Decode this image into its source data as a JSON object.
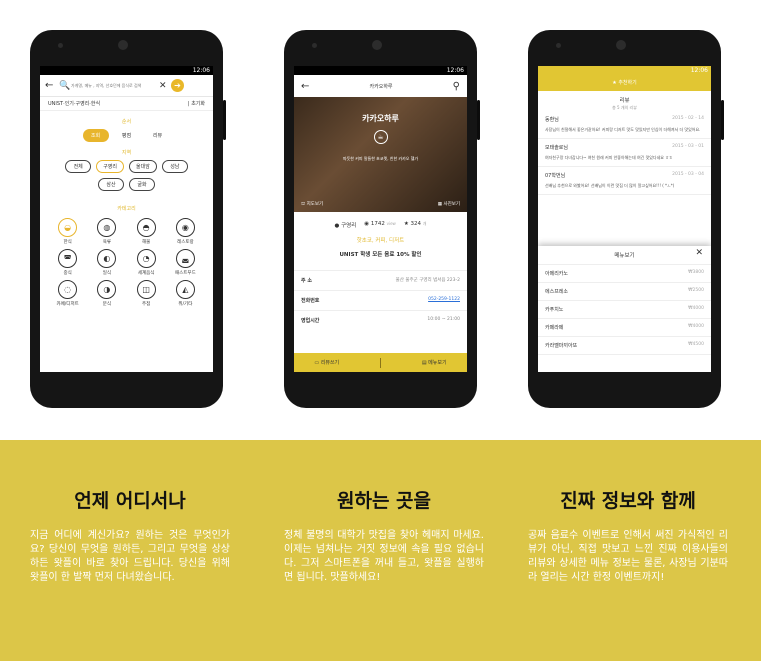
{
  "status_time": "12:06",
  "phone1": {
    "search_placeholder": "가게명, 메뉴 , 지역, 선호던에 음식로 검색",
    "crumb": "UNIST·인기·구영리·한식",
    "reset": "| 초기화",
    "order_title": "순서",
    "orders": [
      "조회",
      "평점",
      "리뷰"
    ],
    "region_title": "지역",
    "regions": [
      "전체",
      "구영리",
      "울대암",
      "성남",
      "삼산",
      "굴화"
    ],
    "category_title": "카테고리",
    "categories": [
      "한식",
      "육류",
      "해물",
      "레스토랑",
      "중식",
      "일식",
      "세계음식",
      "패스트푸드",
      "카페/디저트",
      "분식",
      "주점",
      "뷔/기타"
    ]
  },
  "phone2": {
    "topbar": "카카오하루",
    "shop_name": "카카오하루",
    "shop_desc": "따듯한 커피 말들한 초코렛, 친한 카카오 헬가",
    "map_label": "지도보기",
    "photo_label": "사진보기",
    "location": "구영리",
    "views": "1742",
    "views_unit": "view",
    "score": "324",
    "score_unit": "개",
    "tags": "핫초코, 커피, 디저트",
    "promo": "UNIST 학생 모든 음료 10% 할인",
    "info": [
      {
        "k": "주 소",
        "v": "울산 울주군 구영리 범서읍 223-2"
      },
      {
        "k": "전화번호",
        "v": "052-259-1122"
      },
      {
        "k": "영업시간",
        "v": "10:00 ~ 21:00"
      }
    ],
    "review_btn": "리뷰쓰기",
    "menu_btn": "메뉴보기"
  },
  "phone3": {
    "top": "추천하기",
    "title": "리뷰",
    "subtitle": "총 5 개의 리뷰",
    "reviews": [
      {
        "name": "동환님",
        "date": "2015 - 02 - 14",
        "text": "사장님이 친절해서 좋은거같아요! 커피랑 디저트 맛도 맛있지만 인심이 더해져서 더 맛있어요."
      },
      {
        "name": "모태솔로님",
        "date": "2015 - 03 - 01",
        "text": "여자친구랑 다녀갑니다~ 여친 원래 커피 안좋아해는데 여긴 맛있다네요 ㅎㅎ"
      },
      {
        "name": "07학번님",
        "date": "2015 - 03 - 04",
        "text": "선배님 추천으로 와봤어요! 선배님이 이런 맛집 더 많이 알고싶어요!!! ( *ㅗ*)"
      }
    ],
    "menu_title": "메뉴보기",
    "menu": [
      {
        "n": "아메리카노",
        "p": "₩3800"
      },
      {
        "n": "에스프레소",
        "p": "₩2500"
      },
      {
        "n": "카푸치노",
        "p": "₩4000"
      },
      {
        "n": "카페라떼",
        "p": "₩4000"
      },
      {
        "n": "카라멜마끼아또",
        "p": "₩4500"
      }
    ]
  },
  "features": [
    {
      "title": "언제 어디서나",
      "body": "지금 어디에 계신가요? 원하는 것은 무엇인가요? 당신이 무엇을 원하든, 그리고 무엇을 상상하든 왓플이 바로 찾아 드립니다. 당신을 위해 왓플이 한 발짝 먼저 다녀왔습니다."
    },
    {
      "title": "원하는 곳을",
      "body": "정체 불명의 대학가 맛집을 찾아 헤매지 마세요. 이제는 넘쳐나는 거짓 정보에 속을 필요 없습니다. 그저 스마트폰을 꺼내 들고, 왓플을 실행하면 됩니다. 맛플하세요!"
    },
    {
      "title": "진짜 정보와 함께",
      "body": "공짜 음료수 이벤트로 인해서 써진 가식적인 리뷰가 아닌, 직접 맛보고 느낀 진짜 이용사들의 리뷰와 상세한 메뉴 정보는 물론, 사장님 기분따라 열리는 시간 한정 이벤트까지!"
    }
  ]
}
